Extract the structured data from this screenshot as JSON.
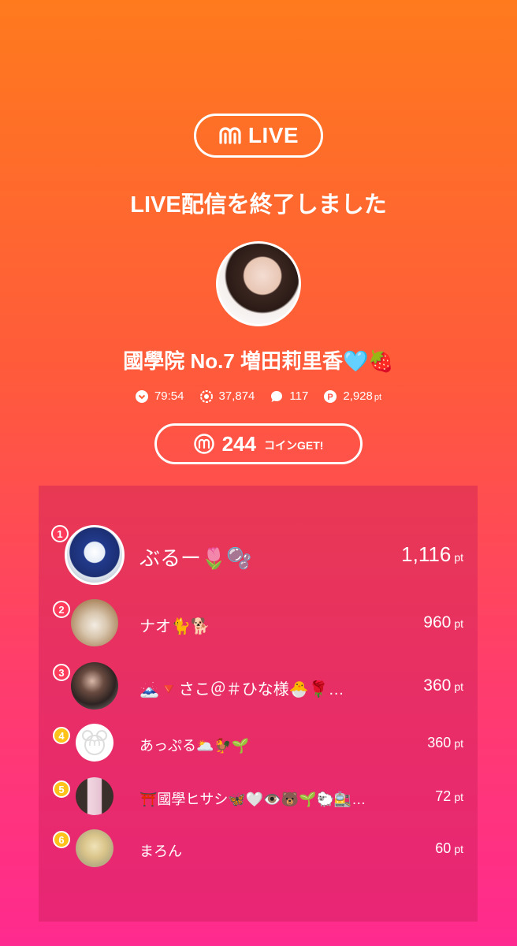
{
  "header": {
    "logo_text": "LIVE",
    "title": "LIVE配信を終了しました"
  },
  "streamer": {
    "name": "國學院 No.7 増田莉里香🩵🍓"
  },
  "stats": [
    {
      "icon": "heart-icon",
      "value": "79:54",
      "unit": ""
    },
    {
      "icon": "viewers-icon",
      "value": "37,874",
      "unit": ""
    },
    {
      "icon": "comment-icon",
      "value": "117",
      "unit": ""
    },
    {
      "icon": "points-icon",
      "value": "2,928",
      "unit": "pt"
    }
  ],
  "coin": {
    "amount": "244",
    "label": "コインGET!"
  },
  "ranking": [
    {
      "rank": "1",
      "name": "ぶるー🌷🫧",
      "points": "1,116",
      "unit": "pt"
    },
    {
      "rank": "2",
      "name": "ナオ🐈🐕",
      "points": "960",
      "unit": "pt"
    },
    {
      "rank": "3",
      "name": "🗻🔻さこ＠＃ひな様🐣🌹…",
      "points": "360",
      "unit": "pt"
    },
    {
      "rank": "4",
      "name": "あっぷる🌥️🐓🌱",
      "points": "360",
      "unit": "pt"
    },
    {
      "rank": "5",
      "name": "⛩️國學ヒサシ🦋🤍👁️🐻🌱🐑🚉…",
      "points": "72",
      "unit": "pt"
    },
    {
      "rank": "6",
      "name": "まろん",
      "points": "60",
      "unit": "pt"
    }
  ],
  "colors": {
    "rank_gold": "#ff8a00",
    "rank_red": "#ff3b5c",
    "rank_yellow": "#ffc21a"
  }
}
